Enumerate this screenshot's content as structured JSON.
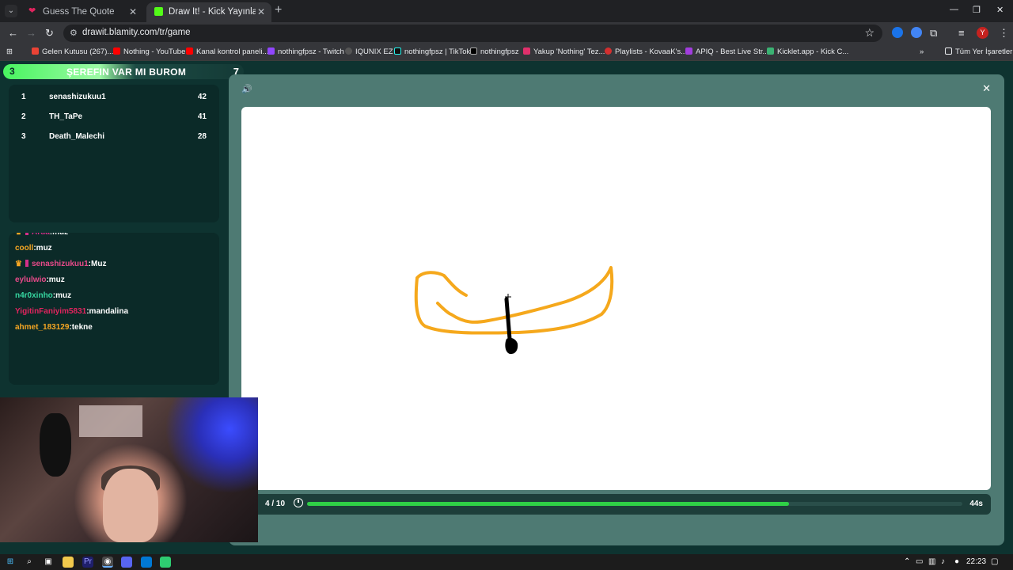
{
  "browser": {
    "tabs": [
      {
        "title": "Guess The Quote",
        "close": "✕"
      },
      {
        "title": "Draw It! - Kick Yayınları İçin Çizim",
        "close": "✕"
      }
    ],
    "new_tab": "+",
    "window_controls": {
      "minimize": "—",
      "restore": "❐",
      "close": "✕"
    },
    "url": "drawit.blamity.com/tr/game",
    "profile_initial": "Y",
    "bookmarks": [
      "Gelen Kutusu (267)...",
      "Nothing - YouTube",
      "Kanal kontrol paneli...",
      "nothingfpsz - Twitch",
      "IQUNIX EZ",
      "nothingfpsz | TikTok",
      "nothingfpsz",
      "Yakup 'Nothing' Tez...",
      "Playlists - KovaaK's...",
      "APIQ - Best Live Str...",
      "Kicklet.app - Kick C..."
    ],
    "all_bookmarks": "Tüm Yer İşaretleri",
    "more_bookmarks": "»",
    "colors": {
      "tab_bar": "#202124",
      "toolbar": "#35363a"
    }
  },
  "game": {
    "team_banner": {
      "rank": "3",
      "name": "ŞEREFIN VAR MI BUROM",
      "score": "7"
    },
    "leaderboard": [
      {
        "pos": "1",
        "player": "senashizukuu1",
        "points": "42"
      },
      {
        "pos": "2",
        "player": "TH_TaPe",
        "points": "41"
      },
      {
        "pos": "3",
        "player": "Death_Malechi",
        "points": "28"
      }
    ],
    "chat": [
      {
        "user": "Arda",
        "message": ":muz",
        "color": "#d42f8a",
        "crown": true,
        "partial": true
      },
      {
        "user": "cooll",
        "message": ":muz",
        "color": "#f5a623",
        "crown": false
      },
      {
        "user": "senashizukuu1",
        "message": ":Muz",
        "color": "#e84a8a",
        "crown": true
      },
      {
        "user": "eylulwio",
        "message": ":muz",
        "color": "#e84a8a",
        "crown": false
      },
      {
        "user": "n4r0xinho",
        "message": ":muz",
        "color": "#36d6a0",
        "crown": false
      },
      {
        "user": "YigitinFaniyim5831",
        "message": ":mandalina",
        "color": "#e0245e",
        "crown": false
      },
      {
        "user": "ahmet_183129",
        "message": ":tekne",
        "color": "#f5a623",
        "crown": false
      }
    ],
    "sound_icon": "🔊",
    "close_icon": "✕",
    "round": "4 / 10",
    "time_left": "44s",
    "time_progress_fraction": 0.735,
    "colors": {
      "page_bg": "#0e3330",
      "panel": "#4e7a73",
      "progress": "#2fd046",
      "stroke_boat": "#f5a81c",
      "stroke_oar": "#000000"
    }
  },
  "taskbar": {
    "clock": "22:23"
  }
}
